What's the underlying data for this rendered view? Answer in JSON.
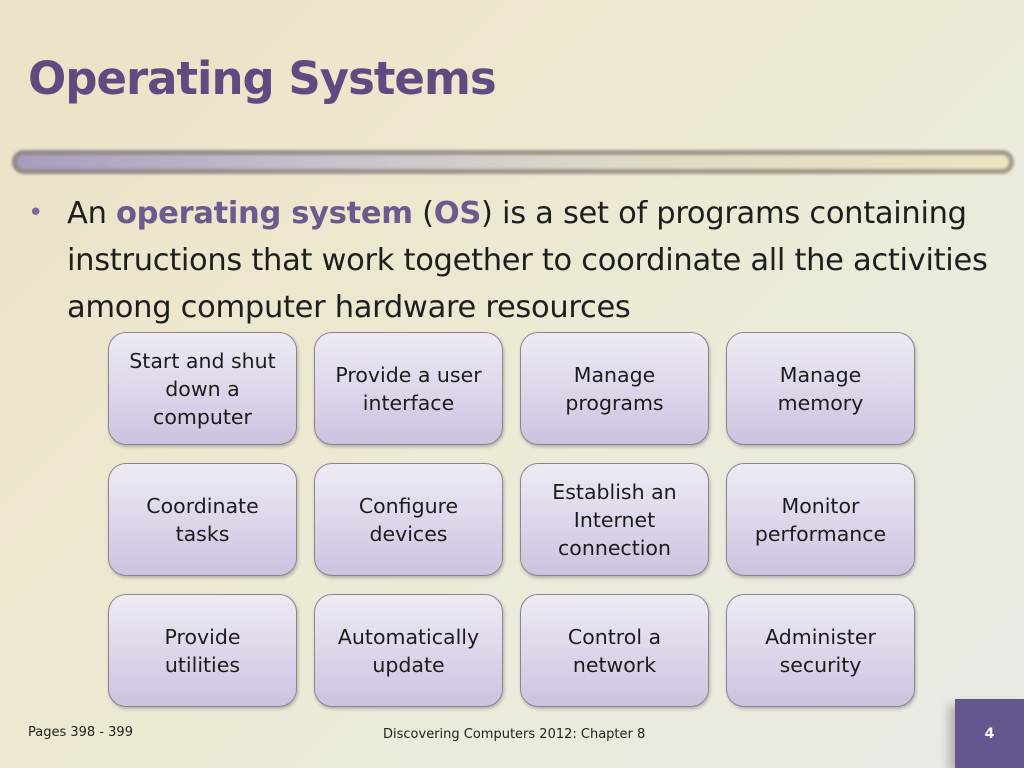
{
  "slide": {
    "title": "Operating Systems",
    "bullet": {
      "marker": "•",
      "prefix": "An ",
      "term": "operating system",
      "open_paren": " (",
      "abbr": "OS",
      "rest": ") is a set of programs containing instructions that work together to coordinate all the activities among computer hardware resources"
    },
    "functions": [
      "Start and shut\ndown a\ncomputer",
      "Provide a user\ninterface",
      "Manage\nprograms",
      "Manage\nmemory",
      "Coordinate\ntasks",
      "Configure\ndevices",
      "Establish an\nInternet\nconnection",
      "Monitor\nperformance",
      "Provide\nutilities",
      "Automatically\nupdate",
      "Control a\nnetwork",
      "Administer\nsecurity"
    ],
    "footer": {
      "pages": "Pages 398 - 399",
      "source": "Discovering Computers 2012: Chapter 8",
      "slide_number": "4"
    },
    "colors": {
      "title": "#5e4c80",
      "highlight": "#6a5a8e",
      "page_tab": "#665690"
    }
  }
}
